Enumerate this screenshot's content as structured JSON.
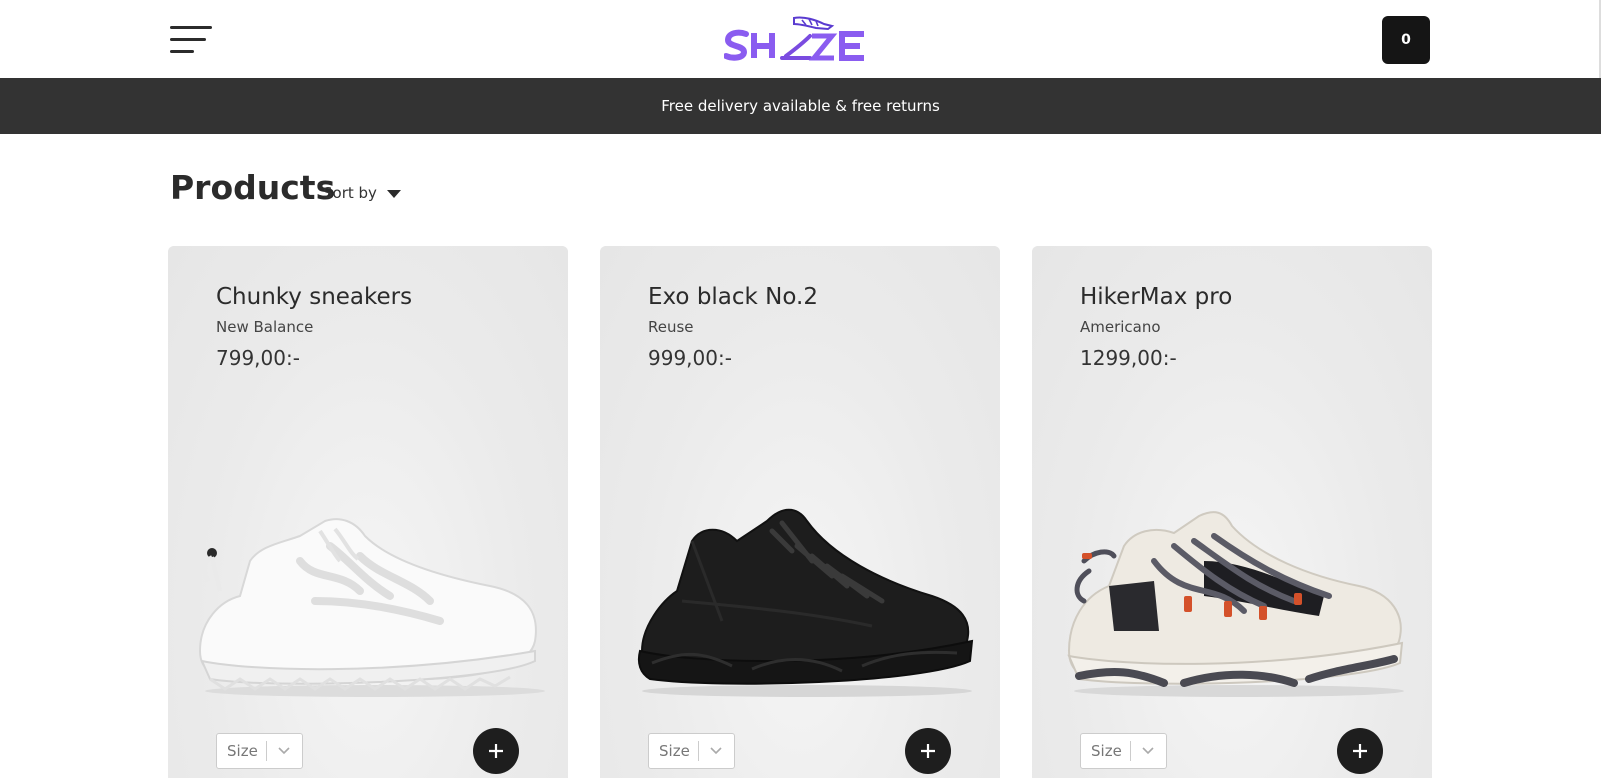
{
  "header": {
    "logo_text": "SHOE",
    "cart_count": "0",
    "colors": {
      "logo": "#8a5cf0",
      "cart_bg": "#151515"
    }
  },
  "banner": {
    "text": "Free delivery available & free returns",
    "bg": "#333333"
  },
  "products_section": {
    "title": "Products",
    "sort_label": "Sort by"
  },
  "products": [
    {
      "name": "Chunky sneakers",
      "brand": "New Balance",
      "price": "799,00:-",
      "size_label": "Size",
      "shoe_color": "white"
    },
    {
      "name": "Exo black No.2",
      "brand": "Reuse",
      "price": "999,00:-",
      "size_label": "Size",
      "shoe_color": "black"
    },
    {
      "name": "HikerMax pro",
      "brand": "Americano",
      "price": "1299,00:-",
      "size_label": "Size",
      "shoe_color": "cream-grey-orange"
    }
  ],
  "icons": [
    "hamburger-menu-icon",
    "shoe-logo-icon",
    "caret-down-icon",
    "chevron-down-icon",
    "plus-icon"
  ]
}
